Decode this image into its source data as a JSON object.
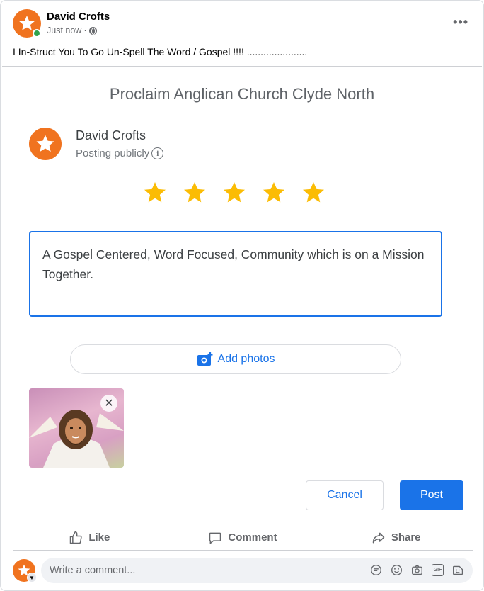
{
  "post": {
    "author": "David Crofts",
    "time": "Just now",
    "separator": "·",
    "text": "I In-Struct You To Go Un-Spell The Word / Gospel !!!! ......................",
    "more_icon": "more-horizontal-icon",
    "privacy_icon": "globe-icon"
  },
  "review": {
    "place": "Proclaim Anglican Church Clyde North",
    "reviewer": "David Crofts",
    "visibility": "Posting publicly",
    "rating": 5,
    "rating_max": 5,
    "star_color": "#fbbc04",
    "text": "A Gospel Centered, Word Focused, Community which is on a Mission Together.",
    "add_photos_label": "Add photos",
    "cancel_label": "Cancel",
    "post_label": "Post",
    "accent_color": "#1a73e8"
  },
  "actions": {
    "like": "Like",
    "comment": "Comment",
    "share": "Share"
  },
  "comment": {
    "placeholder": "Write a comment...",
    "icons": [
      "sticker-icon",
      "emoji-icon",
      "camera-icon",
      "gif-icon",
      "avatar-sticker-icon"
    ],
    "gif_label": "GIF"
  },
  "colors": {
    "avatar": "#f0731f",
    "online": "#31a24c"
  }
}
